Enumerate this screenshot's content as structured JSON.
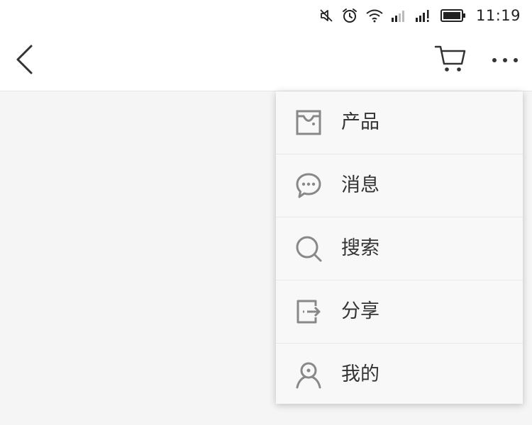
{
  "status_bar": {
    "time": "11:19",
    "icons": [
      "mute-icon",
      "alarm-icon",
      "wifi-icon",
      "signal-icon",
      "signal-icon",
      "battery-icon"
    ]
  },
  "nav": {
    "back_icon": "chevron-left-icon",
    "cart_icon": "cart-icon",
    "more_icon": "more-horizontal-icon"
  },
  "menu": {
    "items": [
      {
        "label": "产品",
        "icon": "shopping-bag-icon"
      },
      {
        "label": "消息",
        "icon": "chat-bubble-icon"
      },
      {
        "label": "搜索",
        "icon": "search-icon"
      },
      {
        "label": "分享",
        "icon": "share-icon"
      },
      {
        "label": "我的",
        "icon": "user-icon"
      }
    ]
  },
  "colors": {
    "icon": "#888888",
    "text": "#333333",
    "background": "#f5f5f5",
    "menu_background": "#f8f8f8"
  }
}
